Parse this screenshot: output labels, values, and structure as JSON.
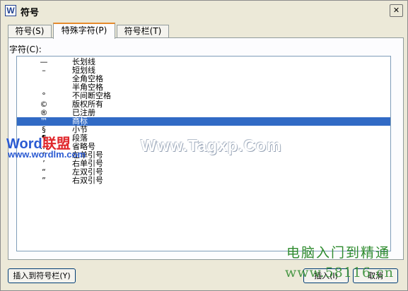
{
  "window": {
    "title": "符号",
    "app_icon": "W"
  },
  "tabs": [
    {
      "label": "符号(S)"
    },
    {
      "label": "特殊字符(P)"
    },
    {
      "label": "符号栏(T)"
    }
  ],
  "chars_label": "字符(C):",
  "list": [
    {
      "symbol": "—",
      "name": "长划线"
    },
    {
      "symbol": "–",
      "name": "短划线"
    },
    {
      "symbol": "",
      "name": "全角空格"
    },
    {
      "symbol": "",
      "name": "半角空格"
    },
    {
      "symbol": "°",
      "name": "不间断空格"
    },
    {
      "symbol": "©",
      "name": "版权所有"
    },
    {
      "symbol": "®",
      "name": "已注册"
    },
    {
      "symbol": "™",
      "name": "商标",
      "selected": true
    },
    {
      "symbol": "§",
      "name": "小节"
    },
    {
      "symbol": "¶",
      "name": "段落"
    },
    {
      "symbol": "…",
      "name": "省略号"
    },
    {
      "symbol": "‘",
      "name": "左单引号"
    },
    {
      "symbol": "’",
      "name": "右单引号"
    },
    {
      "symbol": "“",
      "name": "左双引号"
    },
    {
      "symbol": "”",
      "name": "右双引号"
    }
  ],
  "buttons": {
    "insert": "插入到符号栏(Y)",
    "ok": "插入(I)",
    "cancel": "取消"
  },
  "watermarks": {
    "word_a": "Word",
    "word_b": "联盟",
    "word_url": "www.wordlm.com",
    "center": "Www.Tagxp.Com",
    "cn": "电脑入门到精通",
    "cn_url": "www.58116.cn"
  }
}
